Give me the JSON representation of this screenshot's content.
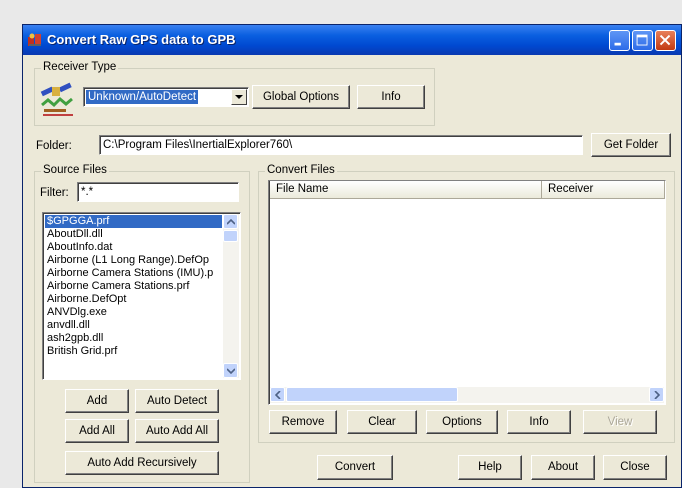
{
  "window": {
    "title": "Convert Raw GPS data to GPB"
  },
  "receiver_type": {
    "group_label": "Receiver Type",
    "selected": "Unknown/AutoDetect",
    "global_options_label": "Global Options",
    "info_label": "Info"
  },
  "folder": {
    "label": "Folder:",
    "value": "C:\\Program Files\\InertialExplorer760\\",
    "get_folder_label": "Get Folder"
  },
  "source_files": {
    "group_label": "Source Files",
    "filter_label": "Filter:",
    "filter_value": "*.*",
    "items": [
      "$GPGGA.prf",
      "AboutDll.dll",
      "AboutInfo.dat",
      "Airborne (L1 Long Range).DefOp",
      "Airborne Camera Stations (IMU).p",
      "Airborne Camera Stations.prf",
      "Airborne.DefOpt",
      "ANVDlg.exe",
      "anvdll.dll",
      "ash2gpb.dll",
      "British Grid.prf"
    ],
    "selected_index": 0,
    "add_label": "Add",
    "auto_detect_label": "Auto Detect",
    "add_all_label": "Add All",
    "auto_add_all_label": "Auto Add All",
    "auto_add_recursively_label": "Auto Add Recursively"
  },
  "convert_files": {
    "group_label": "Convert Files",
    "columns": [
      "File Name",
      "Receiver"
    ],
    "remove_label": "Remove",
    "clear_label": "Clear",
    "options_label": "Options",
    "info_label": "Info",
    "view_label": "View"
  },
  "footer": {
    "convert_label": "Convert",
    "help_label": "Help",
    "about_label": "About",
    "close_label": "Close"
  },
  "colors": {
    "titlebar": "#0048d0",
    "selection": "#316ac5",
    "face": "#ece9d8"
  }
}
